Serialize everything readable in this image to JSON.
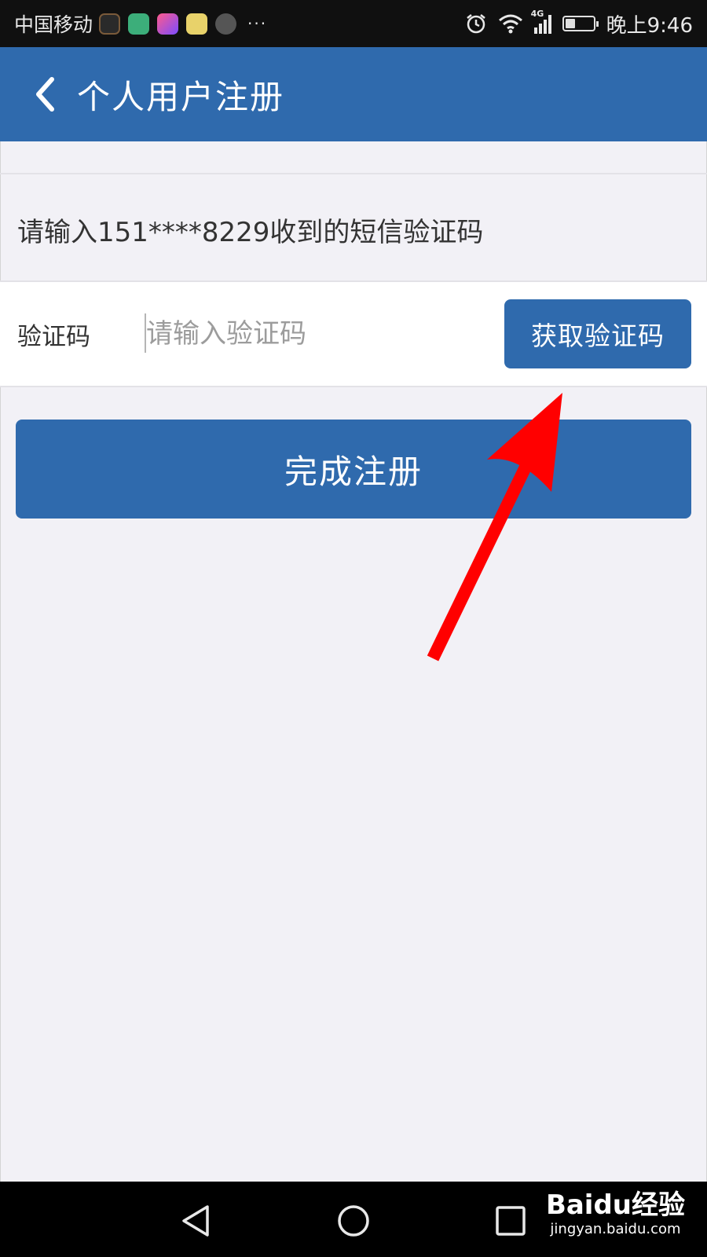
{
  "status_bar": {
    "carrier": "中国移动",
    "more": "···",
    "network": "4G",
    "time": "晚上9:46",
    "battery_level": 0.35,
    "app_icons": [
      "tiktok-icon",
      "meituan-icon",
      "meitu-icon",
      "telegram-icon",
      "camera-app-icon"
    ]
  },
  "header": {
    "title": "个人用户注册"
  },
  "form": {
    "hint": "请输入151****8229收到的短信验证码",
    "code_label": "验证码",
    "code_placeholder": "请输入验证码",
    "code_value": "",
    "get_code_button": "获取验证码",
    "submit_button": "完成注册"
  },
  "watermark": {
    "logo": "Baidu经验",
    "url": "jingyan.baidu.com"
  },
  "colors": {
    "primary": "#2f6aad",
    "background": "#f2f1f6",
    "annotation": "#ff0000"
  }
}
